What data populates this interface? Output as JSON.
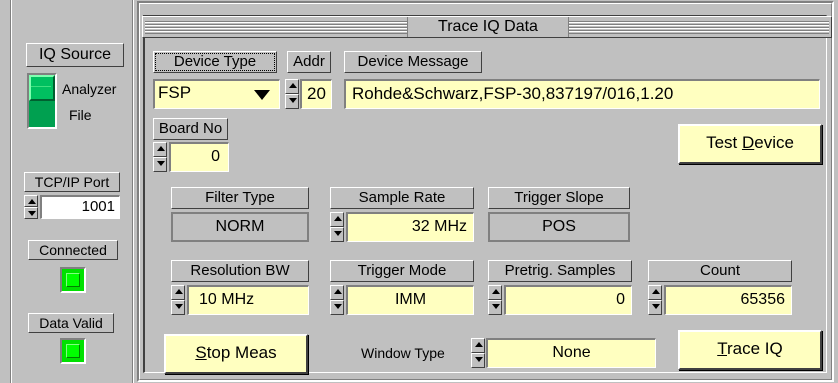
{
  "left_panel": {
    "iq_source": {
      "label": "IQ Source",
      "options": [
        "Analyzer",
        "File"
      ],
      "selected": "Analyzer"
    },
    "tcp_port": {
      "label": "TCP/IP Port",
      "value": "1001"
    },
    "connected": {
      "label": "Connected"
    },
    "data_valid": {
      "label": "Data Valid"
    }
  },
  "main_panel": {
    "title": "Trace IQ Data",
    "device_type": {
      "label": "Device Type",
      "value": "FSP"
    },
    "addr": {
      "label": "Addr",
      "value": "20"
    },
    "device_message": {
      "label": "Device Message",
      "value": "Rohde&Schwarz,FSP-30,837197/016,1.20"
    },
    "board_no": {
      "label": "Board No",
      "value": "0"
    },
    "test_device": {
      "label_pre": "Test ",
      "label_hot": "D",
      "label_post": "evice"
    },
    "filter_type": {
      "label": "Filter Type",
      "value": "NORM"
    },
    "sample_rate": {
      "label": "Sample Rate",
      "value": "32 MHz"
    },
    "trigger_slope": {
      "label": "Trigger Slope",
      "value": "POS"
    },
    "resolution_bw": {
      "label": "Resolution BW",
      "value": "10 MHz"
    },
    "trigger_mode": {
      "label": "Trigger Mode",
      "value": "IMM"
    },
    "pretrig_samples": {
      "label": "Pretrig. Samples",
      "value": "0"
    },
    "count": {
      "label": "Count",
      "value": "65356"
    },
    "stop_meas": {
      "label_hot": "S",
      "label_post": "top Meas"
    },
    "window_type": {
      "label": "Window Type",
      "value": "None"
    },
    "trace_iq": {
      "label_hot": "T",
      "label_post": "race IQ"
    }
  },
  "colors": {
    "panel": "#c0c0c0",
    "field": "#ffffc0",
    "led_on": "#00ff00",
    "toggle": "#00c060"
  }
}
